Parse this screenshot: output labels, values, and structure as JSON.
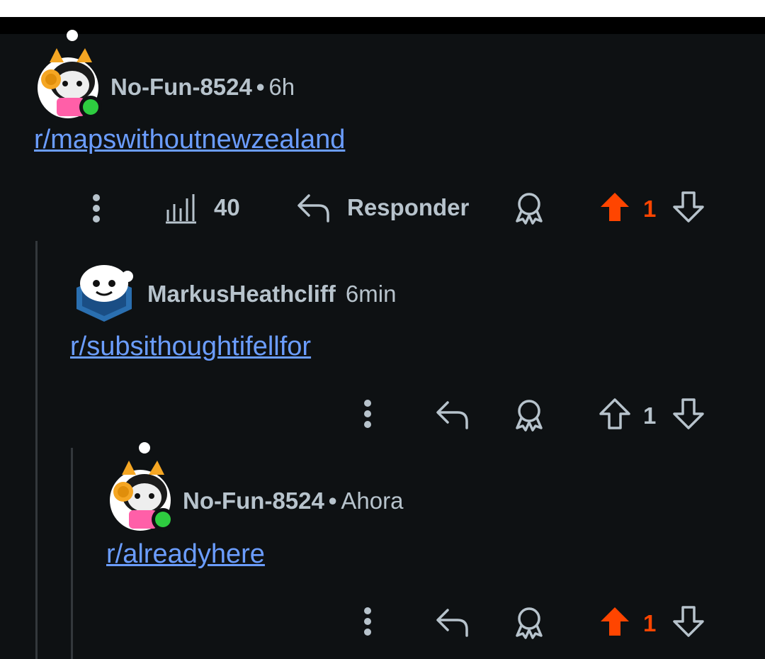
{
  "comments": [
    {
      "username": "No-Fun-8524",
      "separator": "•",
      "time": "6h",
      "link_text": "r/mapswithoutnewzealand",
      "views": "40",
      "reply_label": "Responder",
      "votes": "1",
      "upvoted": true
    },
    {
      "username": "MarkusHeathcliff",
      "time": "6min",
      "link_text": "r/subsithoughtifellfor",
      "votes": "1",
      "upvoted": false
    },
    {
      "username": "No-Fun-8524",
      "separator": "•",
      "time": "Ahora",
      "link_text": "r/alreadyhere",
      "votes": "1",
      "upvoted": true
    }
  ],
  "colors": {
    "background": "#0e1113",
    "text": "#b7c3cc",
    "link": "#6b9dff",
    "upvote": "#ff4500",
    "online": "#2ecc40"
  }
}
